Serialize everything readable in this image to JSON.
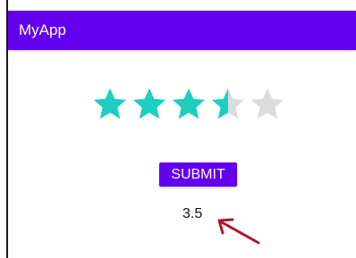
{
  "app_bar": {
    "title": "MyApp",
    "color": "#6200ee"
  },
  "rating": {
    "value": 3.5,
    "max": 5,
    "filled_color": "#1ccfbf",
    "empty_color": "#dcdcdc"
  },
  "submit_button": {
    "label": "SUBMIT"
  },
  "rating_display": {
    "text": "3.5"
  },
  "annotation": {
    "arrow_color": "#b0182a"
  }
}
